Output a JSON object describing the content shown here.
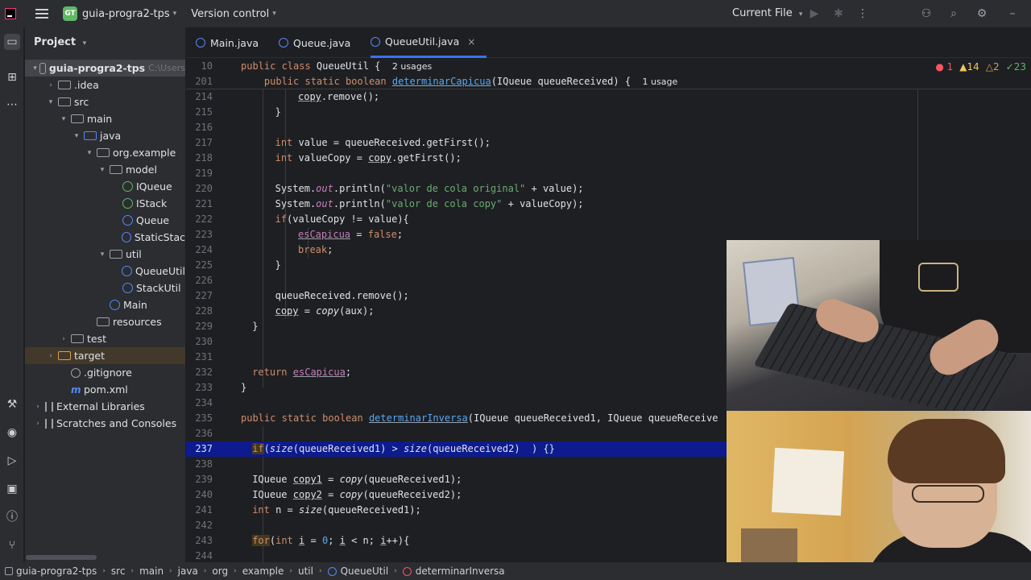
{
  "topbar": {
    "project_badge": "GT",
    "project_name": "guia-progra2-tps",
    "version_control": "Version control",
    "run_config": "Current File"
  },
  "project_panel": {
    "title": "Project",
    "tree": [
      {
        "label": "guia-progra2-tps",
        "extra": "C:\\Users",
        "arrow": "▾",
        "icon": "mod",
        "indent": 0,
        "selected": true
      },
      {
        "label": ".idea",
        "arrow": "›",
        "icon": "folder",
        "indent": 1
      },
      {
        "label": "src",
        "arrow": "▾",
        "icon": "folder",
        "indent": 1
      },
      {
        "label": "main",
        "arrow": "▾",
        "icon": "folder",
        "indent": 2
      },
      {
        "label": "java",
        "arrow": "▾",
        "icon": "folder-blue",
        "indent": 3
      },
      {
        "label": "org.example",
        "arrow": "▾",
        "icon": "folder",
        "indent": 4
      },
      {
        "label": "model",
        "arrow": "▾",
        "icon": "folder",
        "indent": 5
      },
      {
        "label": "IQueue",
        "arrow": "",
        "icon": "iface",
        "indent": 6
      },
      {
        "label": "IStack",
        "arrow": "",
        "icon": "iface",
        "indent": 6
      },
      {
        "label": "Queue",
        "arrow": "",
        "icon": "cls",
        "indent": 6
      },
      {
        "label": "StaticStac",
        "arrow": "",
        "icon": "cls",
        "indent": 6
      },
      {
        "label": "util",
        "arrow": "▾",
        "icon": "folder",
        "indent": 5
      },
      {
        "label": "QueueUtil",
        "arrow": "",
        "icon": "cls",
        "indent": 6
      },
      {
        "label": "StackUtil",
        "arrow": "",
        "icon": "cls",
        "indent": 6
      },
      {
        "label": "Main",
        "arrow": "",
        "icon": "cls",
        "indent": 5
      },
      {
        "label": "resources",
        "arrow": "",
        "icon": "folder",
        "indent": 4
      },
      {
        "label": "test",
        "arrow": "›",
        "icon": "folder",
        "indent": 2
      },
      {
        "label": "target",
        "arrow": "›",
        "icon": "folder-orange",
        "indent": 1,
        "target": true
      },
      {
        "label": ".gitignore",
        "arrow": "",
        "icon": "git",
        "indent": 2
      },
      {
        "label": "pom.xml",
        "arrow": "",
        "icon": "m",
        "indent": 2
      },
      {
        "label": "External Libraries",
        "arrow": "›",
        "icon": "lib",
        "indent": 0
      },
      {
        "label": "Scratches and Consoles",
        "arrow": "›",
        "icon": "lib",
        "indent": 0
      }
    ]
  },
  "tabs": [
    {
      "label": "Main.java",
      "icon": "cls"
    },
    {
      "label": "Queue.java",
      "icon": "cls"
    },
    {
      "label": "QueueUtil.java",
      "icon": "cls",
      "active": true,
      "close": "×"
    }
  ],
  "inspections": {
    "errors": "1",
    "warnings": "14",
    "weak_warnings": "2",
    "ok": "23"
  },
  "editor": {
    "sticky": [
      {
        "num": "10",
        "usage": "2 usages"
      },
      {
        "num": "201",
        "usage": "1 usage"
      }
    ],
    "line_numbers": [
      "214",
      "215",
      "216",
      "217",
      "218",
      "219",
      "220",
      "221",
      "222",
      "223",
      "224",
      "225",
      "226",
      "227",
      "228",
      "229",
      "230",
      "231",
      "232",
      "233",
      "234",
      "235",
      "236",
      "237",
      "238",
      "239",
      "240",
      "241",
      "242",
      "243",
      "244"
    ],
    "string_literals": {
      "s1": "\"valor de cola original\"",
      "s2": "\"valor de cola copy\""
    }
  },
  "statusbar": {
    "crumbs": [
      "guia-progra2-tps",
      "src",
      "main",
      "java",
      "org",
      "example",
      "util",
      "QueueUtil",
      "determinarInversa"
    ]
  },
  "colors": {
    "background": "#1e1f22",
    "panel": "#2b2d30",
    "keyword": "#cf8e6d",
    "string": "#6aab73",
    "static_field": "#c77dbb",
    "function": "#56a8f5",
    "accent": "#3574f0",
    "current_line": "#0d1b8f"
  }
}
